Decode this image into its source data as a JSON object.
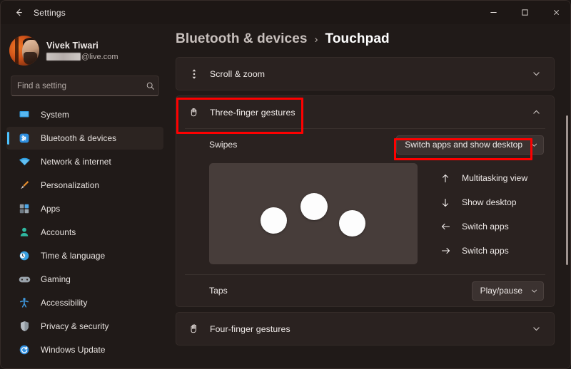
{
  "window": {
    "app_title": "Settings",
    "back_icon": "back-arrow-icon",
    "minimize_label": "–",
    "maximize_label": "▫",
    "close_label": "✕"
  },
  "sidebar": {
    "profile": {
      "name": "Vivek Tiwari",
      "email_visible": "@live.com",
      "email_redacted": true,
      "avatar_icon": "user-avatar"
    },
    "search": {
      "placeholder": "Find a setting",
      "value": "",
      "icon": "search-icon"
    },
    "items": [
      {
        "label": "System",
        "icon": "monitor-icon",
        "selected": false,
        "color": "#38a3e0"
      },
      {
        "label": "Bluetooth & devices",
        "icon": "bluetooth-icon",
        "selected": true,
        "color": "#2e8fe0"
      },
      {
        "label": "Network & internet",
        "icon": "wifi-icon",
        "selected": false,
        "color": "#2f9ee0"
      },
      {
        "label": "Personalization",
        "icon": "paintbrush-icon",
        "selected": false,
        "color": "#e08a2d"
      },
      {
        "label": "Apps",
        "icon": "apps-grid-icon",
        "selected": false,
        "color": "#5b9fd4"
      },
      {
        "label": "Accounts",
        "icon": "person-icon",
        "selected": false,
        "color": "#2fb8a0"
      },
      {
        "label": "Time & language",
        "icon": "clock-globe-icon",
        "selected": false,
        "color": "#3aa0e0"
      },
      {
        "label": "Gaming",
        "icon": "gamepad-icon",
        "selected": false,
        "color": "#9aa3ab"
      },
      {
        "label": "Accessibility",
        "icon": "accessibility-person-icon",
        "selected": false,
        "color": "#3f9ae0"
      },
      {
        "label": "Privacy & security",
        "icon": "shield-icon",
        "selected": false,
        "color": "#b5bcc2"
      },
      {
        "label": "Windows Update",
        "icon": "refresh-circle-icon",
        "selected": false,
        "color": "#2f8fe0"
      }
    ],
    "selected_accent": "#4cc2ff"
  },
  "breadcrumb": {
    "parent": "Bluetooth & devices",
    "separator": "›",
    "current": "Touchpad"
  },
  "panels": {
    "scroll_zoom": {
      "label": "Scroll & zoom",
      "icon": "scroll-vertical-icon",
      "expanded": false,
      "chevron": "chevron-down-icon"
    },
    "three_finger": {
      "label": "Three-finger gestures",
      "icon": "three-finger-hand-icon",
      "expanded": true,
      "chevron": "chevron-up-icon",
      "highlighted": true,
      "swipes": {
        "label": "Swipes",
        "dropdown_value": "Switch apps and show desktop",
        "dropdown_chevron": "chevron-down-icon",
        "highlighted": true
      },
      "gesture_preview": {
        "icon": "touchpad-three-dots-illustration",
        "dot_count": 3
      },
      "actions": [
        {
          "direction": "up",
          "icon": "arrow-up-icon",
          "glyph": "↑",
          "label": "Multitasking view"
        },
        {
          "direction": "down",
          "icon": "arrow-down-icon",
          "glyph": "↓",
          "label": "Show desktop"
        },
        {
          "direction": "left",
          "icon": "arrow-left-icon",
          "glyph": "←",
          "label": "Switch apps"
        },
        {
          "direction": "right",
          "icon": "arrow-right-icon",
          "glyph": "→",
          "label": "Switch apps"
        }
      ],
      "taps": {
        "label": "Taps",
        "dropdown_value": "Play/pause",
        "dropdown_chevron": "chevron-down-icon"
      }
    },
    "four_finger": {
      "label": "Four-finger gestures",
      "icon": "four-finger-hand-icon",
      "expanded": false,
      "chevron": "chevron-down-icon"
    }
  },
  "annotation": {
    "color": "#fe0000",
    "boxes": [
      "three-finger-gestures-header",
      "swipes-dropdown"
    ]
  }
}
